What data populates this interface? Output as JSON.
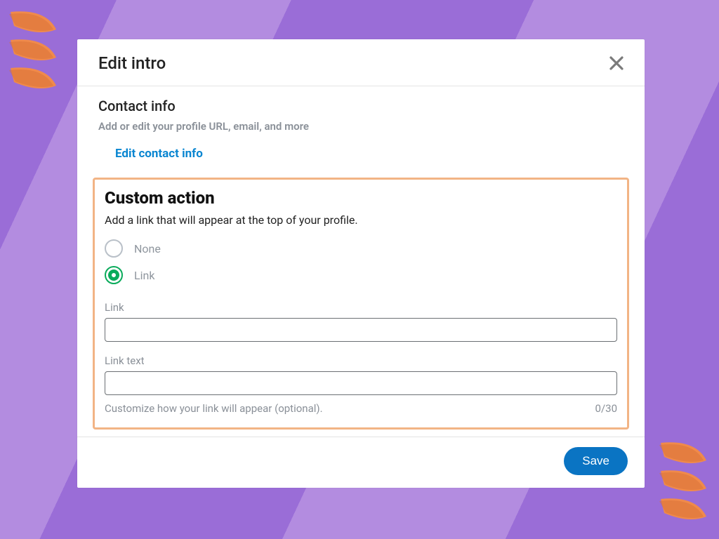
{
  "modal": {
    "title": "Edit intro"
  },
  "contact": {
    "heading": "Contact info",
    "sub": "Add or edit your profile URL, email, and more",
    "edit_link": "Edit contact info"
  },
  "custom": {
    "heading": "Custom action",
    "sub": "Add a link that will appear at the top of your profile.",
    "options": {
      "none": "None",
      "link": "Link"
    },
    "selected": "link",
    "link_field": {
      "label": "Link",
      "value": ""
    },
    "linktext_field": {
      "label": "Link text",
      "value": "",
      "hint": "Customize how your link will appear (optional).",
      "counter": "0/30"
    }
  },
  "footer": {
    "save": "Save"
  }
}
